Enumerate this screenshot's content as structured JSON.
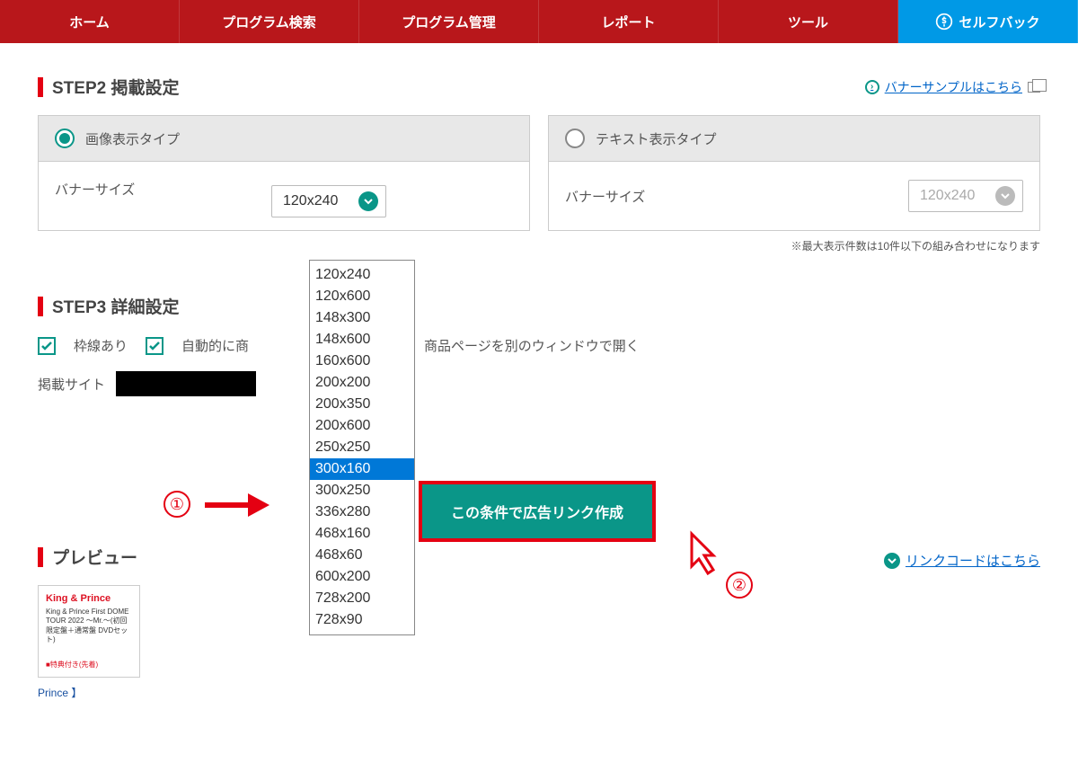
{
  "nav": {
    "home": "ホーム",
    "search": "プログラム検索",
    "manage": "プログラム管理",
    "report": "レポート",
    "tool": "ツール",
    "selfback": "セルフバック"
  },
  "step2": {
    "title": "STEP2 掲載設定",
    "banner_sample": "バナーサンプルはこちら",
    "image_type": "画像表示タイプ",
    "text_type": "テキスト表示タイプ",
    "banner_size": "バナーサイズ",
    "select_value_left": "120x240",
    "select_value_right": "120x240",
    "note": "※最大表示件数は10件以下の組み合わせになります"
  },
  "dropdown": {
    "items": [
      "120x240",
      "120x600",
      "148x300",
      "148x600",
      "160x600",
      "200x200",
      "200x350",
      "200x600",
      "250x250",
      "300x160",
      "300x250",
      "336x280",
      "468x160",
      "468x60",
      "600x200",
      "728x200",
      "728x90"
    ],
    "selected": "300x160"
  },
  "step3": {
    "title": "STEP3 詳細設定",
    "border": "枠線あり",
    "auto": "自動的に商",
    "new_window": "商品ページを別のウィンドウで開く",
    "site": "掲載サイト"
  },
  "create_button": "この条件で広告リンク作成",
  "link_code": "リンクコードはこちら",
  "preview": {
    "title": "プレビュー",
    "card_title": "King & Prince",
    "card_sub": "King & Prince First DOME TOUR 2022 〜Mr.〜(初回限定盤＋通常盤 DVDセット)",
    "card_badge": "■特典付き(先着)",
    "card_foot": "Prince 】"
  },
  "annot": {
    "one": "①",
    "two": "②"
  }
}
